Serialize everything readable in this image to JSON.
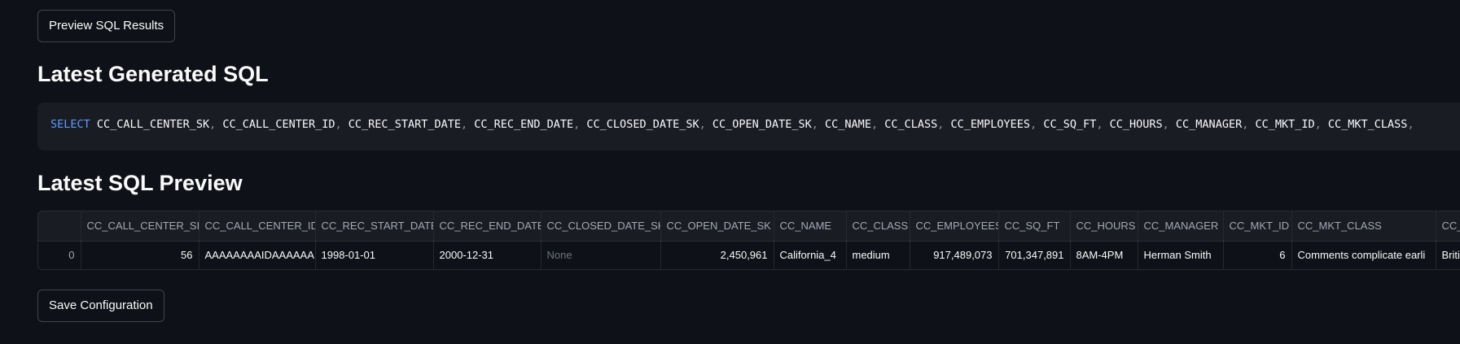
{
  "buttons": {
    "preview": "Preview SQL Results",
    "save": "Save Configuration"
  },
  "headings": {
    "generated_sql": "Latest Generated SQL",
    "sql_preview": "Latest SQL Preview"
  },
  "sql": {
    "keyword": "SELECT",
    "columns": [
      "CC_CALL_CENTER_SK",
      "CC_CALL_CENTER_ID",
      "CC_REC_START_DATE",
      "CC_REC_END_DATE",
      "CC_CLOSED_DATE_SK",
      "CC_OPEN_DATE_SK",
      "CC_NAME",
      "CC_CLASS",
      "CC_EMPLOYEES",
      "CC_SQ_FT",
      "CC_HOURS",
      "CC_MANAGER",
      "CC_MKT_ID",
      "CC_MKT_CLASS"
    ]
  },
  "table": {
    "columns": [
      "",
      "CC_CALL_CENTER_SK",
      "CC_CALL_CENTER_ID",
      "CC_REC_START_DATE",
      "CC_REC_END_DATE",
      "CC_CLOSED_DATE_SK",
      "CC_OPEN_DATE_SK",
      "CC_NAME",
      "CC_CLASS",
      "CC_EMPLOYEES",
      "CC_SQ_FT",
      "CC_HOURS",
      "CC_MANAGER",
      "CC_MKT_ID",
      "CC_MKT_CLASS",
      "CC_MKT_DESC"
    ],
    "rows": [
      [
        "0",
        "56",
        "AAAAAAAAIDAAAAAA",
        "1998-01-01",
        "2000-12-31",
        "None",
        "2,450,961",
        "California_4",
        "medium",
        "917,489,073",
        "701,347,891",
        "8AM-4PM",
        "Herman Smith",
        "6",
        "Comments complicate earli",
        "British p"
      ]
    ]
  },
  "colors": {
    "background": "#0e1117",
    "code_background": "#1a1c24",
    "keyword": "#5c9dff"
  }
}
